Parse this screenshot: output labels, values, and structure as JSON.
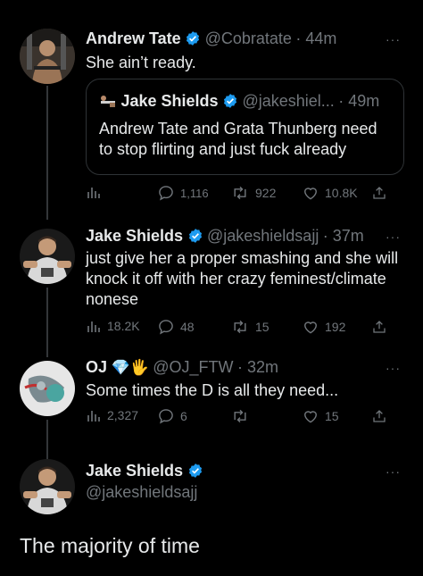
{
  "tweets": [
    {
      "author": "Andrew Tate",
      "handle": "@Cobratate",
      "time": "· 44m",
      "text": "She ain’t ready.",
      "more": "···",
      "quote": {
        "author": "Jake Shields",
        "handle": "@jakeshiel...",
        "time": "· 49m",
        "text": "Andrew Tate and Grata Thunberg need to stop flirting and just fuck already"
      },
      "stats": {
        "views": "",
        "replies": "1,116",
        "retweets": "922",
        "likes": "10.8K"
      }
    },
    {
      "author": "Jake Shields",
      "handle": "@jakeshieldsajj",
      "time": "· 37m",
      "text": "just give her a proper smashing and she will knock it off with her crazy feminest/climate nonese",
      "more": "···",
      "stats": {
        "views": "18.2K",
        "replies": "48",
        "retweets": "15",
        "likes": "192"
      }
    },
    {
      "author": "OJ",
      "author_emoji": "💎🖐",
      "handle": "@OJ_FTW",
      "time": "· 32m",
      "text": "Some times the D is all they need...",
      "more": "···",
      "stats": {
        "views": "2,327",
        "replies": "6",
        "retweets": "",
        "likes": "15"
      }
    },
    {
      "author": "Jake Shields",
      "handle": "@jakeshieldsajj",
      "more": "···",
      "text": "The majority of time"
    }
  ],
  "colors": {
    "background": "#000000",
    "text": "#e7e9ea",
    "muted": "#71767b",
    "verified": "#1d9bf0",
    "divider": "#2f3336"
  }
}
